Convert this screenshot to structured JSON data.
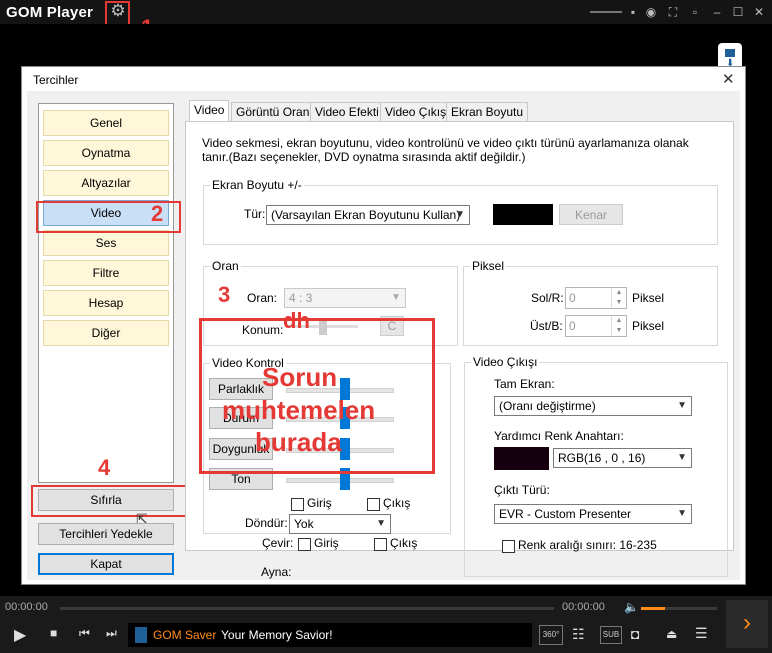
{
  "app": {
    "title": "GOM Player",
    "annotation_1": "1"
  },
  "dialog": {
    "title": "Tercihler",
    "close": "✕",
    "sidebar": [
      {
        "label": "Genel"
      },
      {
        "label": "Oynatma"
      },
      {
        "label": "Altyazılar"
      },
      {
        "label": "Video"
      },
      {
        "label": "Ses"
      },
      {
        "label": "Filtre"
      },
      {
        "label": "Hesap"
      },
      {
        "label": "Diğer"
      }
    ],
    "annotation_2": "2",
    "annotation_4": "4",
    "buttons": {
      "reset": "Sıfırla",
      "backup": "Tercihleri Yedekle",
      "close": "Kapat"
    },
    "tabs": [
      "Video",
      "Görüntü Oranı",
      "Video Efekti",
      "Video Çıkışı",
      "Ekran Boyutu"
    ],
    "description": "Video sekmesi, ekran boyutunu, video kontrolünü ve video çıktı türünü ayarlamanıza olanak tanır.(Bazı seçenekler, DVD oynatma sırasında aktif değildir.)",
    "screen_size": {
      "group": "Ekran Boyutu +/-",
      "type_label": "Tür:",
      "type_value": "(Varsayılan Ekran Boyutunu Kullan)",
      "crop_button": "Kenar"
    },
    "ratio": {
      "group": "Oran",
      "ratio_label": "Oran:",
      "ratio_value": "4 : 3",
      "position_label": "Konum:",
      "c_button": "C"
    },
    "pixel": {
      "group": "Piksel",
      "left_label": "Sol/R:",
      "left_value": "0",
      "left_unit": "Piksel",
      "top_label": "Üst/B:",
      "top_value": "0",
      "top_unit": "Piksel"
    },
    "video_control": {
      "group": "Video Kontrol",
      "buttons": [
        "Parlaklık",
        "Durum",
        "Doygunluk",
        "Ton"
      ],
      "annotation_3": "3",
      "overlay_dh": "dh",
      "overlay_line1": "Sorun",
      "overlay_line2": "muhtemelen",
      "overlay_line3": "burada"
    },
    "flip": {
      "flip_label": "Çevir:",
      "mirror_label": "Ayna:",
      "in": "Giriş",
      "out": "Çıkış",
      "rotate_label": "Döndür:",
      "rotate_value": "Yok"
    },
    "video_output": {
      "group": "Video Çıkışı",
      "fullscreen_label": "Tam Ekran:",
      "fullscreen_value": "(Oranı değiştirme)",
      "colorkey_label": "Yardımcı Renk Anahtarı:",
      "colorkey_value": "RGB(16 , 0 , 16)",
      "output_type_label": "Çıktı Türü:",
      "output_type_value": "EVR - Custom Presenter",
      "range_label": "Renk aralığı sınırı: 16-235"
    }
  },
  "player": {
    "time_left": "00:00:00",
    "time_right": "00:00:00",
    "saver_brand": "GOM Saver",
    "saver_slogan": "Your Memory Savior!",
    "badge_360": "360°",
    "badge_sub": "SUB"
  },
  "colors": {
    "annotation": "#e53935",
    "slider_thumb": "#0078d7",
    "color_swatch": "#160010",
    "accent": "#ff8c1a"
  }
}
